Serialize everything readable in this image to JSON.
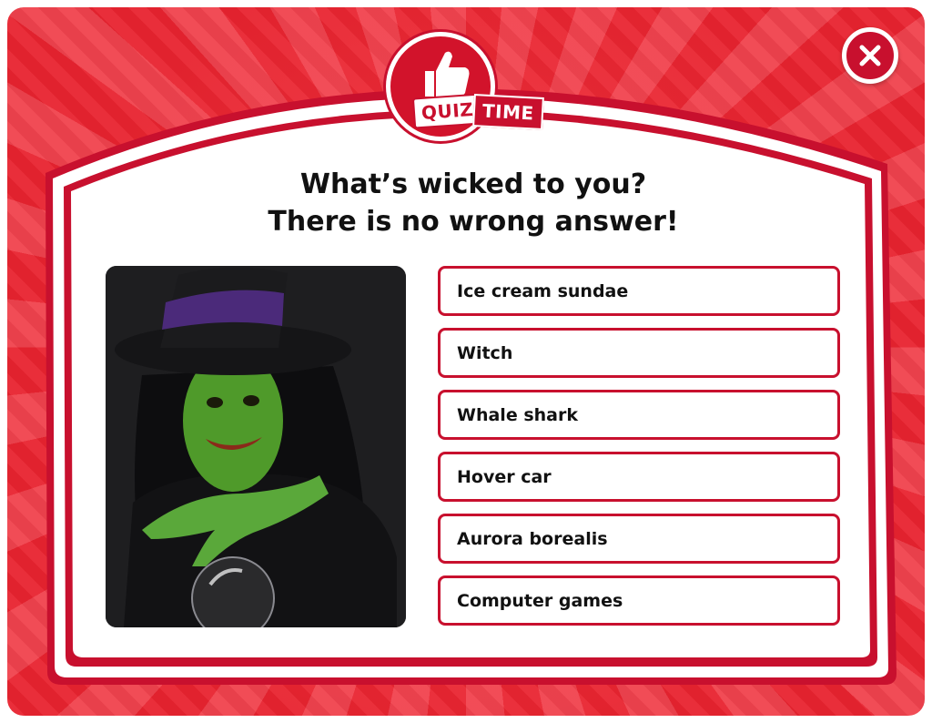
{
  "logo": {
    "quiz": "QUIZ",
    "time": "TIME"
  },
  "question": {
    "line1": "What’s wicked to you?",
    "line2": "There is no wrong answer!"
  },
  "answers": [
    "Ice cream sundae",
    "Witch",
    "Whale shark",
    "Hover car",
    "Aurora borealis",
    "Computer games"
  ],
  "colors": {
    "brand_red": "#c8102e",
    "background_red": "#e8232f",
    "panel": "#ffffff",
    "text": "#111111"
  },
  "icons": {
    "close": "close-icon",
    "logo": "thumbs-up-icon"
  }
}
